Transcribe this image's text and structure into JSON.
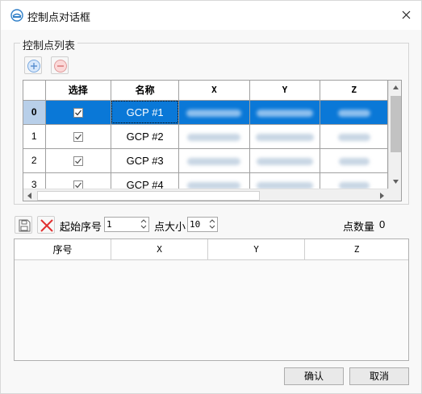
{
  "window": {
    "title": "控制点对话框",
    "logo_icon": "app-logo-icon",
    "close_icon": "close-icon"
  },
  "group": {
    "label": "控制点列表",
    "add_icon": "add-icon",
    "remove_icon": "remove-icon"
  },
  "grid": {
    "columns": [
      "选择",
      "名称",
      "X",
      "Y",
      "Z"
    ],
    "rows": [
      {
        "index": "0",
        "checked": true,
        "name": "GCP #1",
        "selected": true
      },
      {
        "index": "1",
        "checked": true,
        "name": "GCP #2",
        "selected": false
      },
      {
        "index": "2",
        "checked": true,
        "name": "GCP #3",
        "selected": false
      },
      {
        "index": "3",
        "checked": true,
        "name": "GCP #4",
        "selected": false
      }
    ]
  },
  "toolbar": {
    "save_icon": "save-icon",
    "delete_icon": "delete-icon",
    "start_index_label": "起始序号",
    "start_index_value": "1",
    "point_size_label": "点大小",
    "point_size_value": "10",
    "point_count_label": "点数量",
    "point_count_value": "0"
  },
  "table2": {
    "columns": [
      "序号",
      "X",
      "Y",
      "Z"
    ]
  },
  "buttons": {
    "ok": "确认",
    "cancel": "取消"
  },
  "colors": {
    "selection": "#0a78d7",
    "selected_row_header": "#b8cfe9",
    "delete_red": "#e03030"
  }
}
